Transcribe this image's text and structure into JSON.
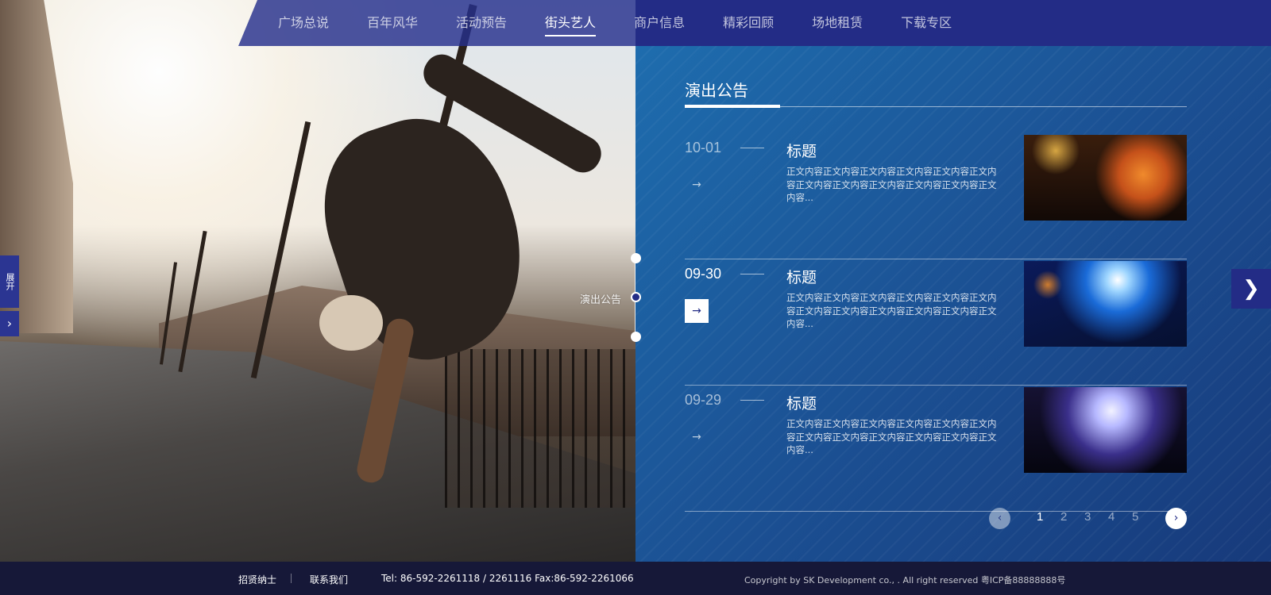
{
  "nav": {
    "items": [
      {
        "label": "广场总说"
      },
      {
        "label": "百年风华"
      },
      {
        "label": "活动预告"
      },
      {
        "label": "街头艺人",
        "active": true
      },
      {
        "label": "商户信息"
      },
      {
        "label": "精彩回顾"
      },
      {
        "label": "场地租赁"
      },
      {
        "label": "下载专区"
      }
    ]
  },
  "side_tab": {
    "label": "展开",
    "arrow": "›"
  },
  "timeline": {
    "label": "演出公告"
  },
  "section": {
    "title": "演出公告"
  },
  "items": [
    {
      "date": "10-01",
      "title": "标题",
      "body": "正文内容正文内容正文内容正文内容正文内容正文内容正文内容正文内容正文内容正文内容正文内容正文内容...",
      "arrow": "→",
      "image": "concert-guitarist-orange-photo"
    },
    {
      "date": "09-30",
      "title": "标题",
      "body": "正文内容正文内容正文内容正文内容正文内容正文内容正文内容正文内容正文内容正文内容正文内容正文内容...",
      "arrow": "→",
      "active": true,
      "image": "bass-guitar-blue-light-photo"
    },
    {
      "date": "09-29",
      "title": "标题",
      "body": "正文内容正文内容正文内容正文内容正文内容正文内容正文内容正文内容正文内容正文内容正文内容正文内容...",
      "arrow": "→",
      "image": "band-stage-silhouette-photo"
    }
  ],
  "pagination": {
    "prev": "‹",
    "next": "›",
    "pages": [
      "1",
      "2",
      "3",
      "4",
      "5"
    ],
    "current": "1"
  },
  "right_arrow": "❯",
  "footer": {
    "link1": "招贤纳士",
    "link2": "联系我们",
    "contact": "Tel: 86-592-2261118  / 2261116  Fax:86-592-2261066",
    "copyright": "Copyright by SK Development co., . All right reserved    粤ICP备88888888号"
  },
  "colors": {
    "nav": "#232c86",
    "panel": "#1b4f92",
    "footer": "#161838",
    "accent": "#ffffff"
  }
}
